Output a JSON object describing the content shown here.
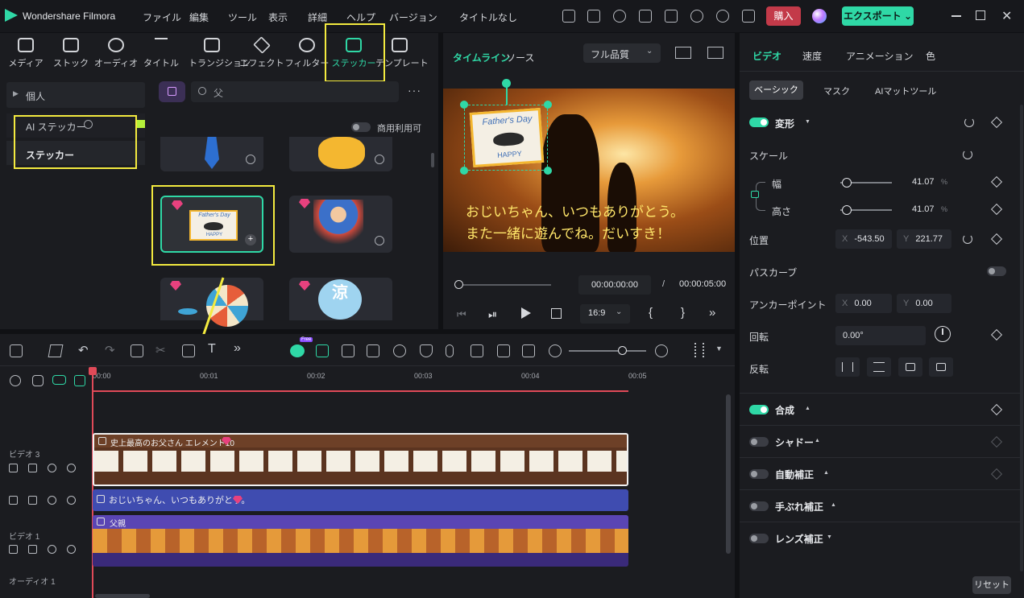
{
  "app": {
    "name": "Wondershare Filmora",
    "project_title": "タイトルなし",
    "buy_label": "購入",
    "export_label": "エクスポート"
  },
  "menu": [
    "ファイル",
    "編集",
    "ツール",
    "表示",
    "詳細",
    "ヘルプ",
    "バージョン"
  ],
  "media_tabs": [
    {
      "label": "メディア",
      "icon": "media-icon"
    },
    {
      "label": "ストック",
      "icon": "stock-icon"
    },
    {
      "label": "オーディオ",
      "icon": "audio-icon"
    },
    {
      "label": "タイトル",
      "icon": "title-icon"
    },
    {
      "label": "トランジション",
      "icon": "transition-icon"
    },
    {
      "label": "エフェクト",
      "icon": "effect-icon"
    },
    {
      "label": "フィルター",
      "icon": "filter-icon"
    },
    {
      "label": "ステッカー",
      "icon": "sticker-icon"
    },
    {
      "label": "テンプレート",
      "icon": "template-icon"
    }
  ],
  "sidebar": {
    "items": [
      "個人",
      "AI ステッカー",
      "ステッカー"
    ]
  },
  "search": {
    "value": "父"
  },
  "commercial_label": "商用利用可",
  "stickers": [
    {
      "title": "tie"
    },
    {
      "title": "bear"
    },
    {
      "title": "Father's Day",
      "tag": "HAPPY"
    },
    {
      "title": "dad"
    },
    {
      "title": "fan"
    },
    {
      "title": "涼"
    }
  ],
  "preview": {
    "tab_timeline": "タイムライン",
    "tab_source": "ソース",
    "quality": "フル品質",
    "caption_line1": "おじいちゃん、いつもありがとう。",
    "caption_line2": "また一緒に遊んでね。だいすき！",
    "sticker_title": "Father's Day",
    "sticker_sub": "HAPPY",
    "current_time": "00:00:00:00",
    "separator": "/",
    "total_time": "00:00:05:00",
    "ratio": "16:9"
  },
  "timeline": {
    "ticks": [
      "00:00",
      "00:01",
      "00:02",
      "00:03",
      "00:04",
      "00:05"
    ],
    "tracks": [
      {
        "label": "ビデオ 3",
        "clip": "史上最高のお父さん エレメント10"
      },
      {
        "label": "",
        "clip": "おじいちゃん、いつもありがとう。"
      },
      {
        "label": "ビデオ 1",
        "clip": "父親"
      },
      {
        "label": "オーディオ 1",
        "clip": ""
      }
    ],
    "new_badge": "Free"
  },
  "inspector": {
    "tabs": [
      "ビデオ",
      "速度",
      "アニメーション",
      "色"
    ],
    "subtabs": [
      "ベーシック",
      "マスク",
      "AIマットツール"
    ],
    "transform": "変形",
    "scale": "スケール",
    "width_label": "幅",
    "height_label": "高さ",
    "width": "41.07",
    "height": "41.07",
    "percent": "%",
    "position": "位置",
    "pos_x_label": "X",
    "pos_x": "-543.50",
    "pos_y_label": "Y",
    "pos_y": "221.77",
    "perspective": "パスカーブ",
    "anchor": "アンカーポイント",
    "anchor_x": "0.00",
    "anchor_y": "0.00",
    "rotation": "回転",
    "rotation_value": "0.00°",
    "flip": "反転",
    "composite": "合成",
    "shadow": "シャドー",
    "auto_enhance": "自動補正",
    "stabilize": "手ぶれ補正",
    "lens": "レンズ補正",
    "reset": "リセット"
  }
}
